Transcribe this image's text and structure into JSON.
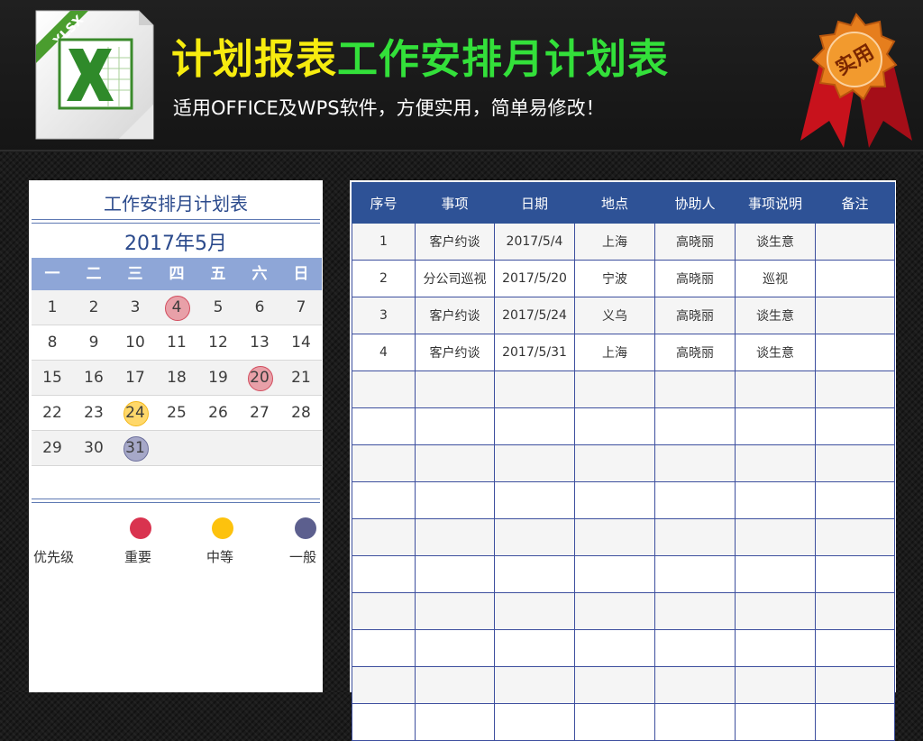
{
  "header": {
    "icon_tag": "XLSX",
    "title_part1": "计划报表",
    "title_part2": "工作安排月计划表",
    "subtitle": "适用OFFICE及WPS软件，方便实用，简单易修改！",
    "badge": "实用"
  },
  "calendar": {
    "title": "工作安排月计划表",
    "month": "2017年5月",
    "weekdays": [
      "一",
      "二",
      "三",
      "四",
      "五",
      "六",
      "日"
    ],
    "weeks": [
      [
        {
          "d": "1"
        },
        {
          "d": "2"
        },
        {
          "d": "3"
        },
        {
          "d": "4",
          "p": "imp"
        },
        {
          "d": "5"
        },
        {
          "d": "6"
        },
        {
          "d": "7"
        }
      ],
      [
        {
          "d": "8"
        },
        {
          "d": "9"
        },
        {
          "d": "10"
        },
        {
          "d": "11"
        },
        {
          "d": "12"
        },
        {
          "d": "13"
        },
        {
          "d": "14"
        }
      ],
      [
        {
          "d": "15"
        },
        {
          "d": "16"
        },
        {
          "d": "17"
        },
        {
          "d": "18"
        },
        {
          "d": "19"
        },
        {
          "d": "20",
          "p": "imp"
        },
        {
          "d": "21"
        }
      ],
      [
        {
          "d": "22"
        },
        {
          "d": "23"
        },
        {
          "d": "24",
          "p": "mid"
        },
        {
          "d": "25"
        },
        {
          "d": "26"
        },
        {
          "d": "27"
        },
        {
          "d": "28"
        }
      ],
      [
        {
          "d": "29"
        },
        {
          "d": "30"
        },
        {
          "d": "31",
          "p": "gen"
        },
        {
          "d": ""
        },
        {
          "d": ""
        },
        {
          "d": ""
        },
        {
          "d": ""
        }
      ]
    ]
  },
  "legend": {
    "label": "优先级",
    "items": [
      {
        "label": "重要",
        "color": "#d9334f"
      },
      {
        "label": "中等",
        "color": "#fdc20d"
      },
      {
        "label": "一般",
        "color": "#5c5f8e"
      }
    ]
  },
  "table": {
    "headers": [
      "序号",
      "事项",
      "日期",
      "地点",
      "协助人",
      "事项说明",
      "备注"
    ],
    "rows": [
      [
        "1",
        "客户约谈",
        "2017/5/4",
        "上海",
        "高晓丽",
        "谈生意",
        ""
      ],
      [
        "2",
        "分公司巡视",
        "2017/5/20",
        "宁波",
        "高晓丽",
        "巡视",
        ""
      ],
      [
        "3",
        "客户约谈",
        "2017/5/24",
        "义乌",
        "高晓丽",
        "谈生意",
        ""
      ],
      [
        "4",
        "客户约谈",
        "2017/5/31",
        "上海",
        "高晓丽",
        "谈生意",
        ""
      ],
      [
        "",
        "",
        "",
        "",
        "",
        "",
        ""
      ],
      [
        "",
        "",
        "",
        "",
        "",
        "",
        ""
      ],
      [
        "",
        "",
        "",
        "",
        "",
        "",
        ""
      ],
      [
        "",
        "",
        "",
        "",
        "",
        "",
        ""
      ],
      [
        "",
        "",
        "",
        "",
        "",
        "",
        ""
      ],
      [
        "",
        "",
        "",
        "",
        "",
        "",
        ""
      ],
      [
        "",
        "",
        "",
        "",
        "",
        "",
        ""
      ],
      [
        "",
        "",
        "",
        "",
        "",
        "",
        ""
      ],
      [
        "",
        "",
        "",
        "",
        "",
        "",
        ""
      ],
      [
        "",
        "",
        "",
        "",
        "",
        "",
        ""
      ]
    ]
  },
  "colors": {
    "title_yellow": "#f7ec0f",
    "title_green": "#33e03a",
    "table_header": "#2e5296",
    "weekday_header": "#8ea6d7"
  }
}
